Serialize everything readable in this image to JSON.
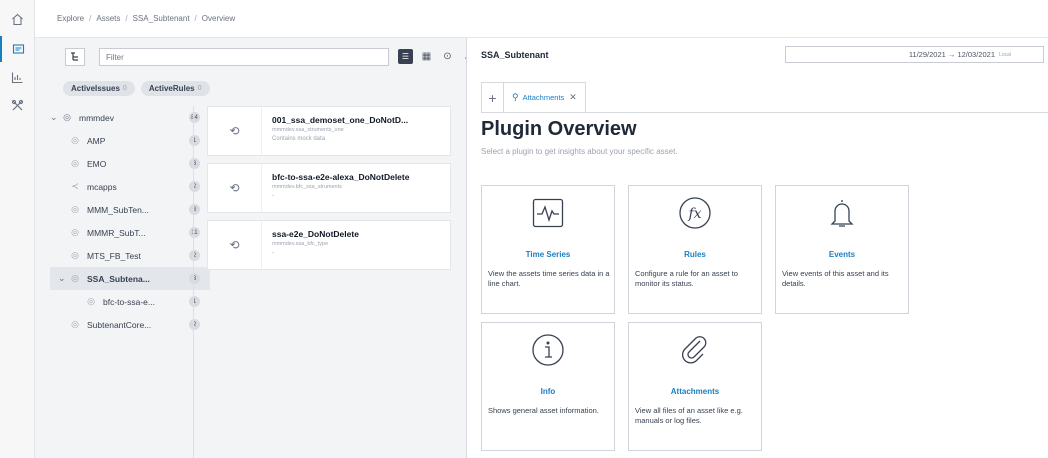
{
  "rail": {
    "items": [
      "home-icon",
      "asset-browser-icon",
      "chart-icon",
      "tools-icon"
    ]
  },
  "breadcrumb": [
    "Explore",
    "Assets",
    "SSA_Subtenant",
    "Overview"
  ],
  "asset_panel": {
    "filter_placeholder": "Filter",
    "chips": [
      {
        "label": "ActiveIssues",
        "count": "0"
      },
      {
        "label": "ActiveRules",
        "count": "0"
      }
    ],
    "tree": [
      {
        "label": "mmmdev",
        "badge": "84",
        "expanded": true,
        "level": 0
      },
      {
        "label": "AMP",
        "badge": "1",
        "level": 1
      },
      {
        "label": "EMO",
        "badge": "3",
        "level": 1
      },
      {
        "label": "mcapps",
        "badge": "2",
        "level": 1
      },
      {
        "label": "MMM_SubTen...",
        "badge": "3",
        "level": 1
      },
      {
        "label": "MMMR_SubT...",
        "badge": "11",
        "level": 1
      },
      {
        "label": "MTS_FB_Test",
        "badge": "2",
        "level": 1
      },
      {
        "label": "SSA_Subtena...",
        "badge": "3",
        "level": 1,
        "selected": true,
        "expanded": true
      },
      {
        "label": "bfc-to-ssa-e...",
        "badge": "1",
        "level": 2
      },
      {
        "label": "SubtenantCore...",
        "badge": "2",
        "level": 1
      }
    ],
    "assets": [
      {
        "name": "001_ssa_demoset_one_DoNotD...",
        "path": "mmmdev.ssa_struments_one",
        "desc": "Contains mock data"
      },
      {
        "name": "bfc-to-ssa-e2e-alexa_DoNotDelete",
        "path": "mmmdev.bfc_ssa_struments",
        "desc": "-"
      },
      {
        "name": "ssa-e2e_DoNotDelete",
        "path": "mmmdev.ssa_bfc_type",
        "desc": "-"
      }
    ]
  },
  "right_panel": {
    "asset_title": "SSA_Subtenant",
    "date_range": "11/29/2021 → 12/03/2021",
    "date_tag": "Local",
    "tab_label": "Attachments",
    "heading": "Plugin Overview",
    "subheading": "Select a plugin to get insights about your specific asset.",
    "plugins": [
      {
        "title": "Time Series",
        "desc": "View the assets time series data in a line chart.",
        "icon": "time-series-icon"
      },
      {
        "title": "Rules",
        "desc": "Configure a rule for an asset to monitor its status.",
        "icon": "function-icon"
      },
      {
        "title": "Events",
        "desc": "View events of this asset and its details.",
        "icon": "bell-icon"
      },
      {
        "title": "Info",
        "desc": "Shows general asset information.",
        "icon": "info-icon"
      },
      {
        "title": "Attachments",
        "desc": "View all files of an asset like e.g. manuals or log files.",
        "icon": "paperclip-icon"
      }
    ]
  },
  "colors": {
    "accent": "#1a7fc1",
    "panel_bg": "#f3f4f6"
  }
}
